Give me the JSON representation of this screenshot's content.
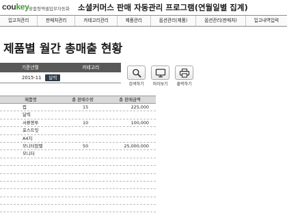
{
  "header": {
    "brand_main": "cou",
    "brand_accent": "key",
    "brand_sub": "맞춤형엑셀업무자동화",
    "title": "소셜커머스 판매 자동관리 프로그램(연월일별 집계)"
  },
  "nav": {
    "items": [
      "입고처관리",
      "판매처관리",
      "카테고리관리",
      "제품관리",
      "옵션관리(제품)",
      "옵션관리(판매처)",
      "입고내역입력"
    ]
  },
  "page": {
    "title": "제품별 월간 총매출 현황"
  },
  "filter": {
    "period_header": "기준년월",
    "category_header": "카테고리",
    "period_value": "2015-11",
    "calendar_button": "달력"
  },
  "tools": {
    "search_label": "검색하기",
    "preview_label": "미리보기",
    "print_label": "출력하기",
    "search_icon": "search-icon",
    "preview_icon": "monitor-icon",
    "print_icon": "printer-icon"
  },
  "table": {
    "headers": [
      "제품명",
      "총 판매수량",
      "총 판매금액"
    ],
    "rows": [
      {
        "product": "컵",
        "quantity": "15",
        "amount": "225,000"
      },
      {
        "product": "달력",
        "quantity": "",
        "amount": ""
      },
      {
        "product": "서류봉투",
        "quantity": "10",
        "amount": "100,000"
      },
      {
        "product": "포스트잇",
        "quantity": "",
        "amount": ""
      },
      {
        "product": "A4지",
        "quantity": "",
        "amount": ""
      },
      {
        "product": "모니터암벨",
        "quantity": "50",
        "amount": "25,000,000"
      },
      {
        "product": "모니터",
        "quantity": "",
        "amount": ""
      },
      {
        "product": "",
        "quantity": "",
        "amount": ""
      },
      {
        "product": "",
        "quantity": "",
        "amount": ""
      },
      {
        "product": "",
        "quantity": "",
        "amount": ""
      },
      {
        "product": "",
        "quantity": "",
        "amount": ""
      },
      {
        "product": "",
        "quantity": "",
        "amount": ""
      },
      {
        "product": "",
        "quantity": "",
        "amount": ""
      },
      {
        "product": "",
        "quantity": "",
        "amount": ""
      }
    ]
  }
}
